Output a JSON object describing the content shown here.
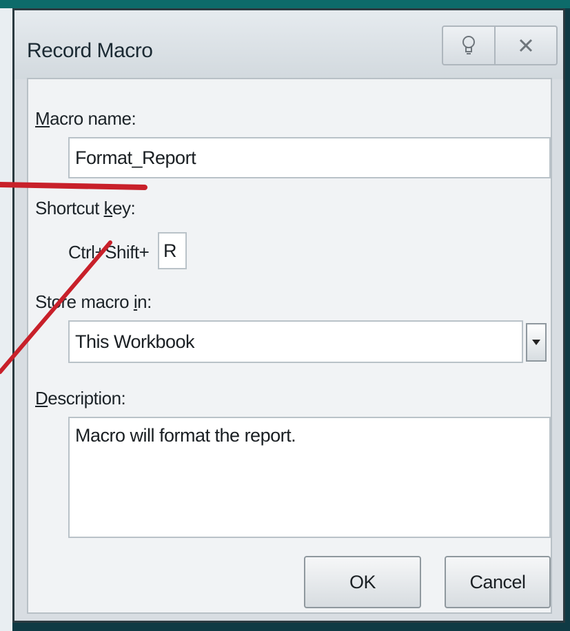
{
  "dialog": {
    "title": "Record Macro",
    "help_icon": "lightbulb-icon",
    "close_icon": "close-icon"
  },
  "macro_name": {
    "label_accel": "M",
    "label_rest": "acro name:",
    "value": "Format_Report"
  },
  "shortcut": {
    "label_pre": "Shortcut ",
    "label_accel": "k",
    "label_post": "ey:",
    "prefix": "Ctrl+Shift+",
    "value": "R"
  },
  "store": {
    "label_pre": "Store macro ",
    "label_accel": "i",
    "label_post": "n:",
    "value": "This Workbook",
    "dropdown_icon": "dropdown-arrow-icon"
  },
  "description": {
    "label_accel": "D",
    "label_rest": "escription:",
    "value": "Macro will format the report."
  },
  "buttons": {
    "ok": "OK",
    "cancel": "Cancel"
  },
  "colors": {
    "annotation_line": "#c8202a",
    "frame": "#0f3a44"
  }
}
